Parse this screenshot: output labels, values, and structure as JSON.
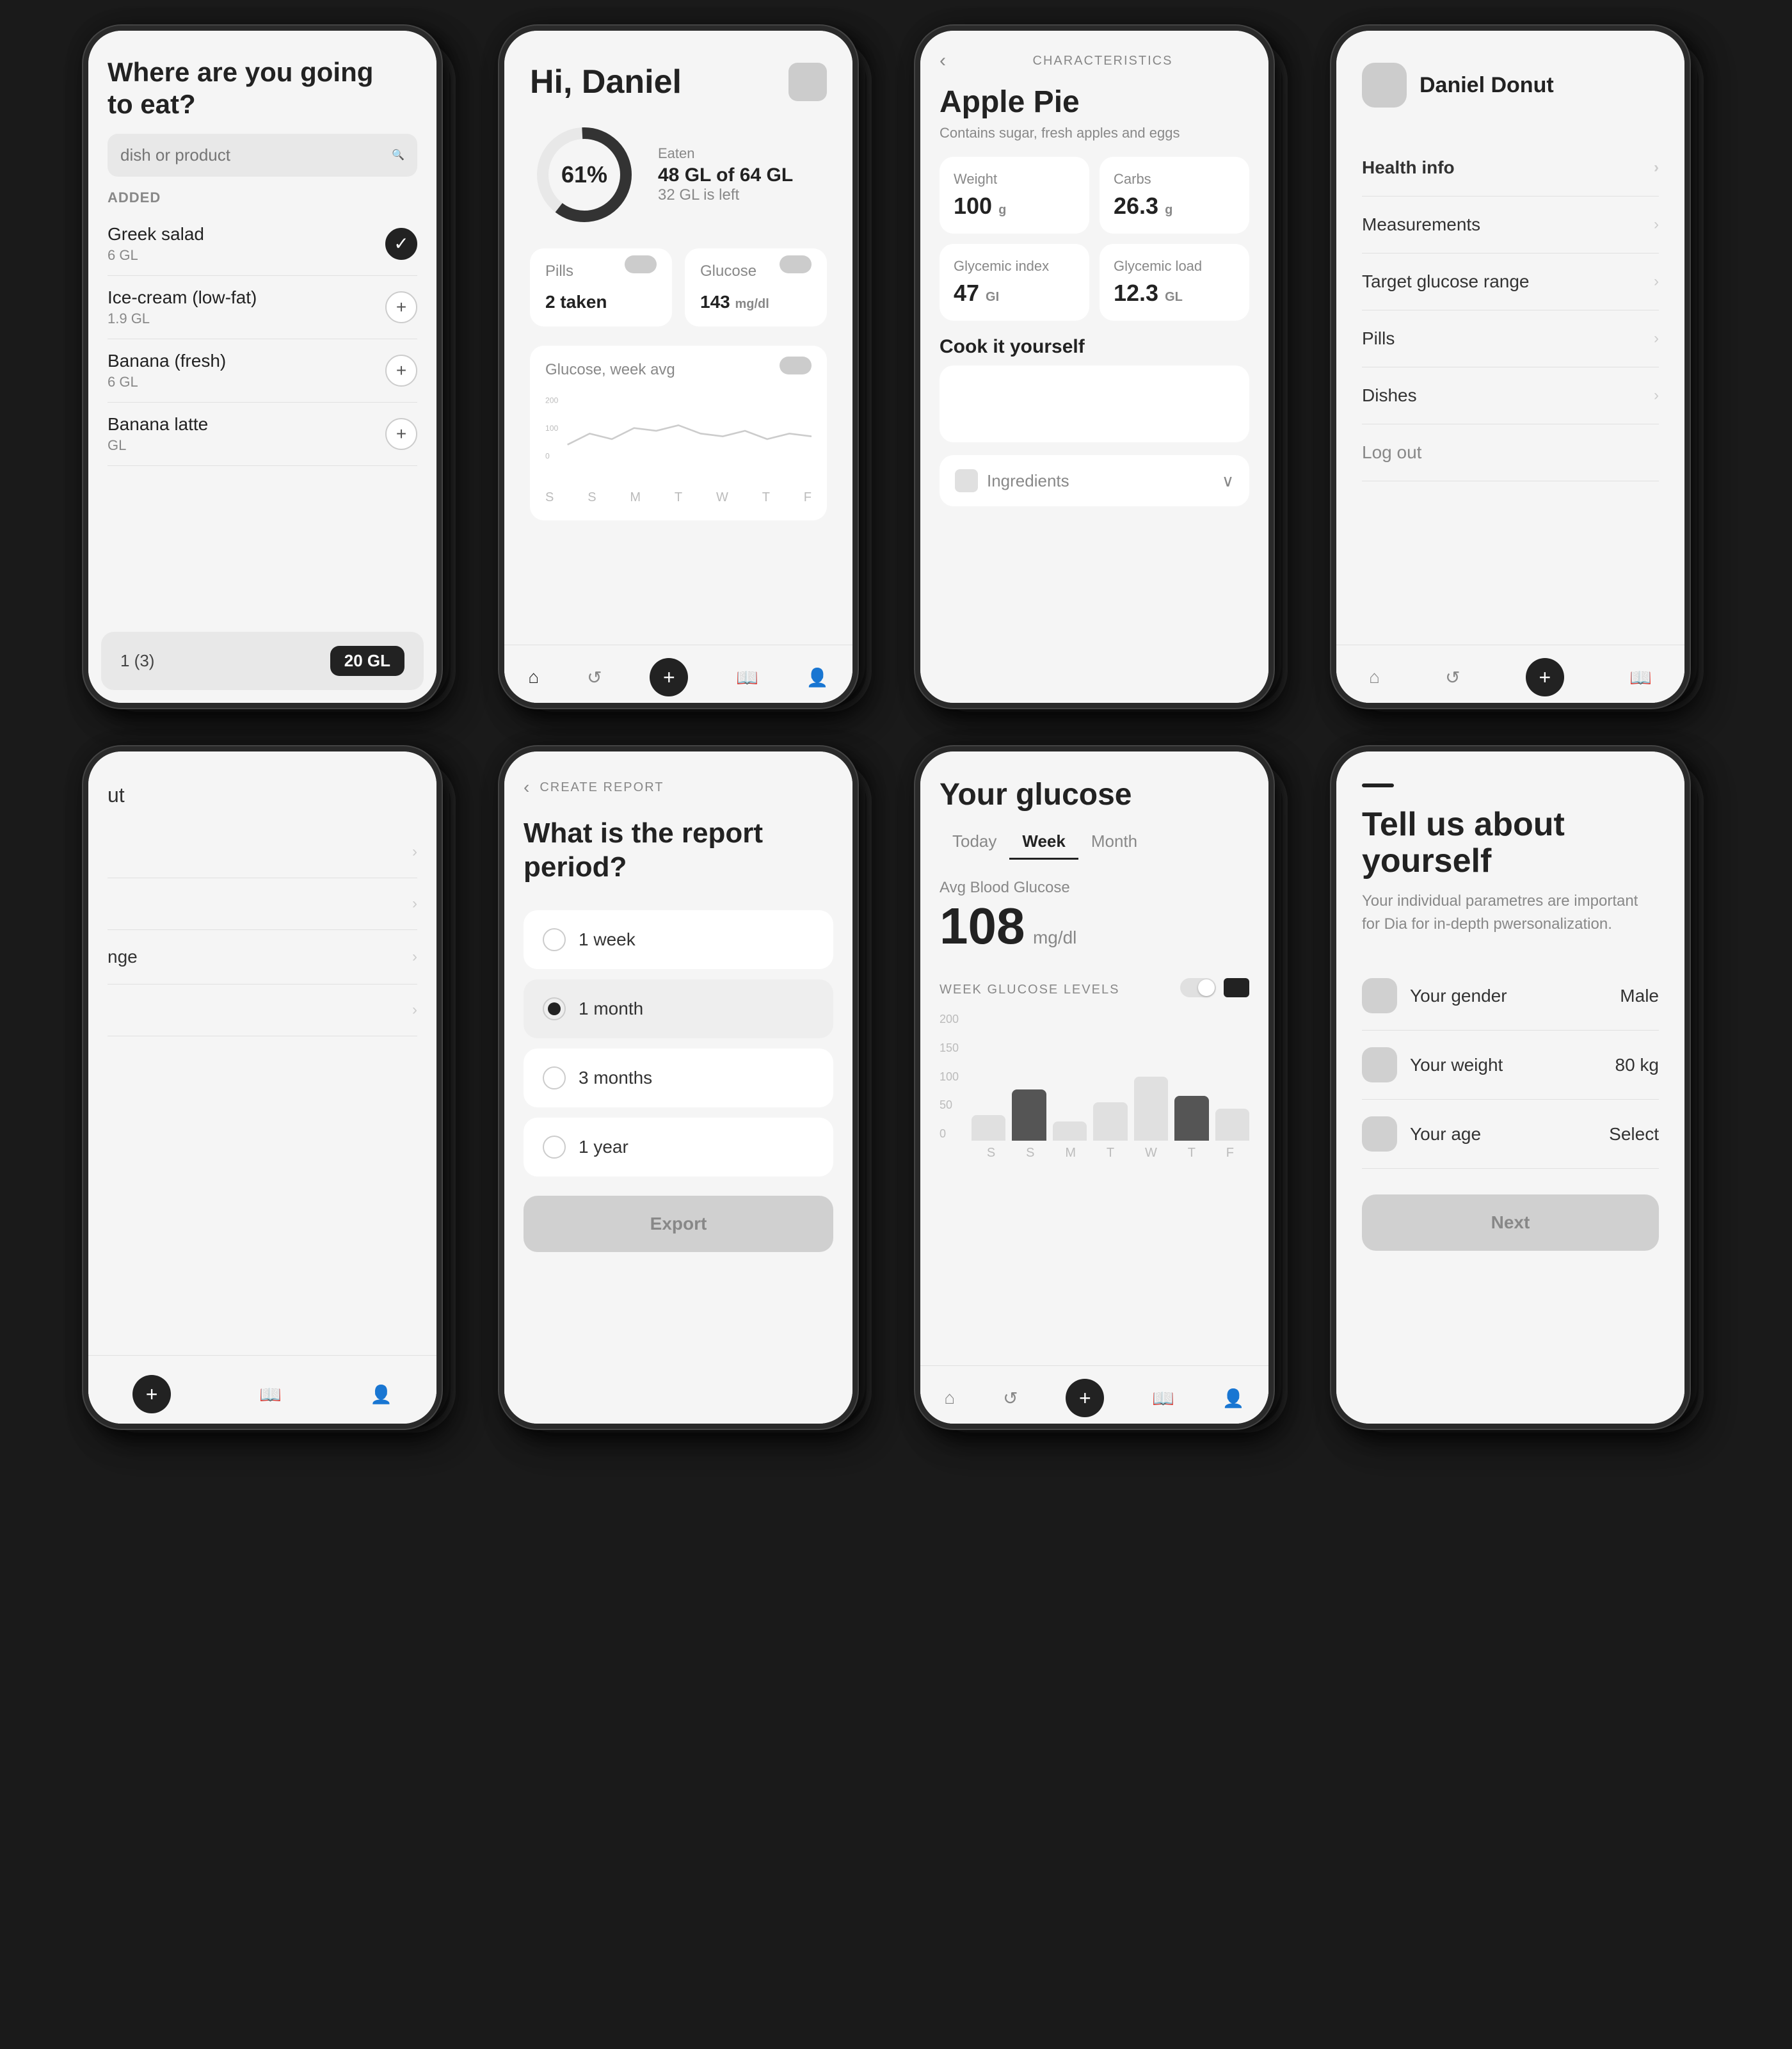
{
  "screens": {
    "search": {
      "title_line1": "Where are you going",
      "title_line2": "to eat?",
      "search_placeholder": "dish or product",
      "added_label": "ADDED",
      "items": [
        {
          "name": "Greek salad",
          "gl": "6 GL",
          "action": "check"
        },
        {
          "name": "Ice-cream (low-fat)",
          "gl": "1.9 GL",
          "action": "plus"
        },
        {
          "name": "Banana (fresh)",
          "gl": "6 GL",
          "action": "plus"
        },
        {
          "name": "Banana latte",
          "gl": "GL",
          "action": "plus"
        }
      ],
      "bottom_count": "1 (3)",
      "bottom_gl": "20 GL"
    },
    "dashboard": {
      "greeting": "Hi, Daniel",
      "donut_pct": "61%",
      "eaten_label": "Eaten",
      "eaten_val": "48 GL of 64 GL",
      "left_val": "32 GL is left",
      "pills_label": "Pills",
      "pills_val": "2 taken",
      "glucose_label": "Glucose",
      "glucose_val": "143",
      "glucose_unit": "mg/dl",
      "chart_title": "Glucose, week avg",
      "chart_y": [
        "200",
        "100",
        "0"
      ],
      "chart_x": [
        "S",
        "S",
        "M",
        "T",
        "W",
        "T",
        "F"
      ],
      "nav": [
        "home",
        "back",
        "add",
        "book",
        "person"
      ]
    },
    "detail": {
      "back": "<",
      "char_label": "CHARACTERISTICS",
      "title": "Apple Pie",
      "subtitle": "Contains sugar, fresh apples and eggs",
      "nutrients": [
        {
          "label": "Weight",
          "val": "100",
          "unit": "g"
        },
        {
          "label": "Carbs",
          "val": "26.3",
          "unit": "g"
        },
        {
          "label": "Glycemic index",
          "val": "47",
          "unit": "GI"
        },
        {
          "label": "Glycemic load",
          "val": "12.3",
          "unit": "GL"
        }
      ],
      "cook_title": "Cook it yourself",
      "ingredients_label": "Ingredients"
    },
    "menu": {
      "user_name": "Daniel Donut",
      "items": [
        {
          "label": "Health info",
          "active": true
        },
        {
          "label": "Measurements"
        },
        {
          "label": "Target glucose range"
        },
        {
          "label": "Pills"
        },
        {
          "label": "Dishes"
        },
        {
          "label": "Log out"
        }
      ],
      "nav": [
        "home",
        "back",
        "add",
        "book"
      ]
    },
    "partial_left": {
      "logout_label": "ut",
      "items": [
        {
          "label": "",
          "chevron": true
        },
        {
          "label": "",
          "chevron": true
        },
        {
          "label": "nge",
          "chevron": true
        },
        {
          "label": "",
          "chevron": true
        }
      ],
      "nav": [
        "add",
        "book",
        "person"
      ]
    },
    "create_report": {
      "back": "<",
      "header_label": "CREATE REPORT",
      "title": "What is the report period?",
      "options": [
        {
          "label": "1 week",
          "selected": false
        },
        {
          "label": "1 month",
          "selected": true
        },
        {
          "label": "3 months",
          "selected": false
        },
        {
          "label": "1 year",
          "selected": false
        }
      ],
      "export_label": "Export"
    },
    "glucose": {
      "title": "Your glucose",
      "tabs": [
        "Today",
        "Week",
        "Month"
      ],
      "active_tab": "Week",
      "avg_label": "Avg Blood Glucose",
      "avg_val": "108",
      "avg_unit": "mg/dl",
      "week_label": "WEEK GLUCOSE LEVELS",
      "chart_y": [
        "200",
        "150",
        "100",
        "50",
        "0"
      ],
      "chart_x": [
        "S",
        "S",
        "M",
        "T",
        "W",
        "T",
        "F"
      ],
      "bars": [
        {
          "height": 40,
          "highlight": false
        },
        {
          "height": 80,
          "highlight": true
        },
        {
          "height": 30,
          "highlight": false
        },
        {
          "height": 60,
          "highlight": false
        },
        {
          "height": 100,
          "highlight": false
        },
        {
          "height": 70,
          "highlight": true
        },
        {
          "height": 50,
          "highlight": false
        }
      ],
      "nav": [
        "home",
        "back",
        "add",
        "book",
        "person"
      ]
    },
    "about": {
      "title": "Tell us about yourself",
      "subtitle": "Your individual parametres are important for Dia for in-depth pwersonalization.",
      "fields": [
        {
          "label": "Your gender",
          "val": "Male"
        },
        {
          "label": "Your weight",
          "val": "80 kg"
        },
        {
          "label": "Your age",
          "val": "Select"
        }
      ],
      "next_label": "Next"
    }
  }
}
